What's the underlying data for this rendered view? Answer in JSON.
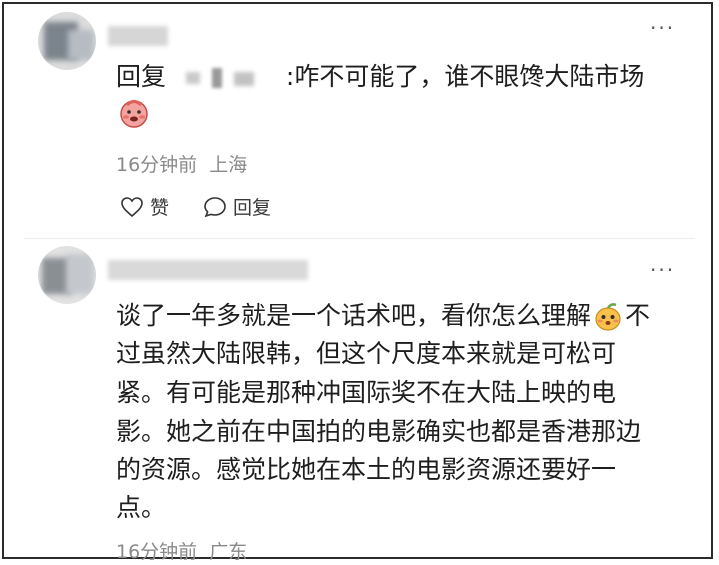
{
  "comment1": {
    "reply_prefix": "回复",
    "reply_text": ":咋不可能了，谁不眼馋大陆市场",
    "emoji": "blushing-face-emoji",
    "time": "16分钟前",
    "location": "上海",
    "like_label": "赞",
    "reply_label": "回复"
  },
  "comment2": {
    "lines": [
      "谈了一年多就是一个话术吧，看你怎么理解",
      "过虽然大陆限韩，但这个尺度本来就是可松可",
      "紧。有可能是那种冲国际奖不在大陆上映的电",
      "影。她之前在中国拍的电影确实也都是香港那边",
      "的资源。感觉比她在本土的电影资源还要好一",
      "点。"
    ],
    "line1_tail": "不",
    "emoji": "mango-face-emoji",
    "time": "16分钟前",
    "location": "广东"
  },
  "more_glyph": "···"
}
